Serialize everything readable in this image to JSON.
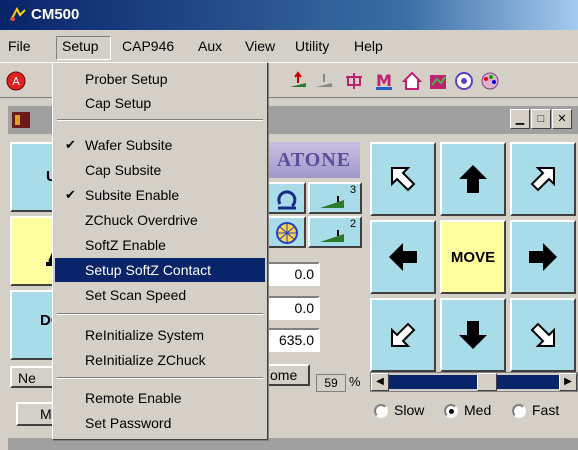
{
  "window": {
    "title": "CM500"
  },
  "menubar": {
    "items": [
      {
        "label": "File"
      },
      {
        "label": "Setup"
      },
      {
        "label": "CAP946"
      },
      {
        "label": "Aux"
      },
      {
        "label": "View"
      },
      {
        "label": "Utility"
      },
      {
        "label": "Help"
      }
    ]
  },
  "setup_menu": {
    "items": [
      {
        "label": "Prober Setup",
        "checked": false
      },
      {
        "label": "Cap Setup",
        "checked": false
      },
      {
        "label": "Wafer Subsite",
        "checked": true
      },
      {
        "label": "Cap Subsite",
        "checked": false
      },
      {
        "label": "Subsite Enable",
        "checked": true
      },
      {
        "label": "ZChuck Overdrive",
        "checked": false
      },
      {
        "label": "SoftZ Enable",
        "checked": false
      },
      {
        "label": "Setup SoftZ Contact",
        "checked": false,
        "highlighted": true
      },
      {
        "label": "Set Scan Speed",
        "checked": false
      },
      {
        "label": "ReInitialize System",
        "checked": false
      },
      {
        "label": "ReInitialize ZChuck",
        "checked": false
      },
      {
        "label": "Remote Enable",
        "checked": false
      },
      {
        "label": "Set Password",
        "checked": false
      }
    ],
    "check_glyph": "✔"
  },
  "panel": {
    "brand_header": "ATONE",
    "fields": [
      "0.0",
      "0.0",
      "635.0"
    ],
    "home_label": "ome",
    "percent_value": "59",
    "percent_sign": "%",
    "partial_left_labels": [
      "U",
      "DC",
      "Ne",
      "M"
    ],
    "badge_3": "3",
    "badge_2": "2"
  },
  "move_pad": {
    "center_label": "MOVE"
  },
  "speed": {
    "options": [
      {
        "label": "Slow",
        "selected": false
      },
      {
        "label": "Med",
        "selected": true
      },
      {
        "label": "Fast",
        "selected": false
      }
    ]
  },
  "colors": {
    "cyan_button": "#a8dce8",
    "yellow_button": "#ffffa0",
    "highlight": "#0a246a",
    "titlebar": "#0a246a"
  }
}
